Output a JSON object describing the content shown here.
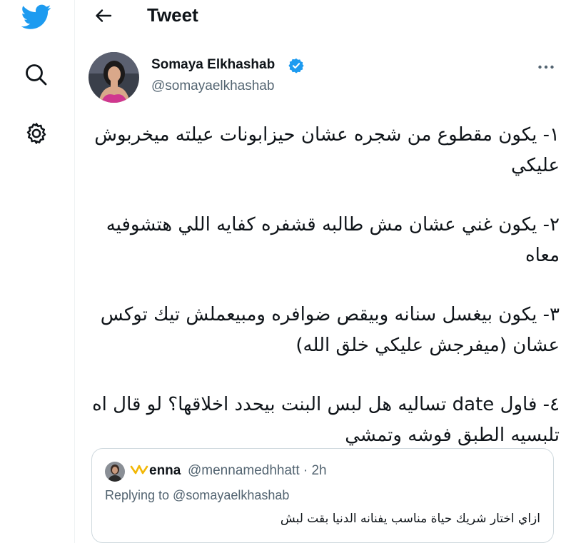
{
  "colors": {
    "accent": "#1d9bf0",
    "text": "#0f1419",
    "muted": "#536471",
    "border": "#cfd9de"
  },
  "sidebar": {
    "icons": [
      "twitter-logo-icon",
      "search-icon",
      "settings-icon"
    ]
  },
  "header": {
    "title": "Tweet"
  },
  "tweet": {
    "author_name": "Somaya Elkhashab",
    "handle": "@somayaelkhashab",
    "verified": true,
    "paragraphs": [
      "١- يكون مقطوع من شجره عشان حيزابونات عيلته ميخربوش عليكي",
      "٢- يكون غني عشان مش طالبه قشفره كفايه اللي هتشوفيه معاه",
      "٣- يكون بيغسل سنانه وبيقص ضوافره ومبيعملش تيك توكس عشان (ميفرجش عليكي خلق الله)",
      "٤- فاول date تساليه هل لبس البنت بيحدد اخلاقها؟ لو قال اه تلبسيه الطبق فوشه وتمشي"
    ]
  },
  "quote": {
    "name": "enna",
    "handle_time": "@mennamedhhatt · 2h",
    "replying": "Replying to @somayaelkhashab",
    "text": "ازاي اختار شريك حياة مناسب يفنانه الدنيا بقت لبش"
  }
}
